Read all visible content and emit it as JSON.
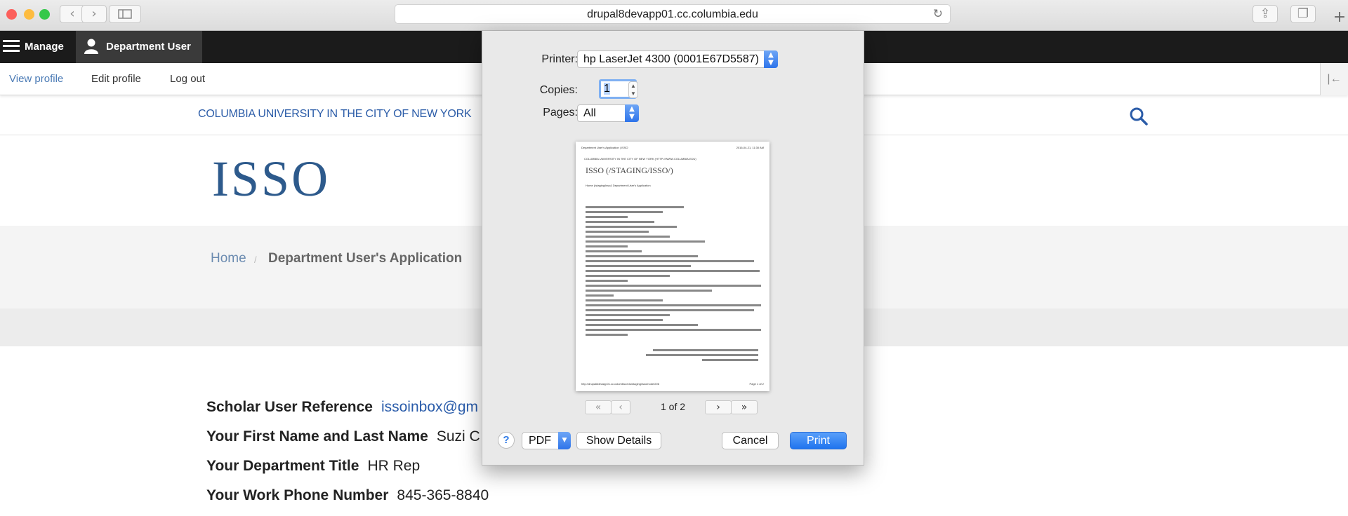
{
  "browser": {
    "url": "drupal8devapp01.cc.columbia.edu",
    "traffic_light_colors": [
      "#fc605c",
      "#fdbc40",
      "#34c84a"
    ],
    "back_icon": "chevron-left-icon",
    "forward_icon": "chevron-right-icon",
    "sidebar_icon": "sidebar-icon",
    "reload_icon": "reload-icon",
    "share_icon": "share-icon",
    "tabs_icon": "tabs-icon",
    "new_tab_icon": "plus-icon"
  },
  "toolbar": {
    "manage_label": "Manage",
    "user_label": "Department User"
  },
  "tray": {
    "view_profile": "View profile",
    "edit_profile": "Edit profile",
    "log_out": "Log out"
  },
  "site": {
    "university": "COLUMBIA UNIVERSITY IN THE CITY OF NEW YORK",
    "logo": "ISSO",
    "breadcrumb_home": "Home",
    "breadcrumb_sep": "/",
    "breadcrumb_current": "Department User's Application",
    "accent_color": "#2b5ca8"
  },
  "fields": [
    {
      "label": "Scholar User Reference",
      "value": "issoinbox@gm"
    },
    {
      "label": "Your First Name and Last Name",
      "value": "Suzi C"
    },
    {
      "label": "Your Department Title",
      "value": "HR Rep"
    },
    {
      "label": "Your Work Phone Number",
      "value": "845-365-8840"
    }
  ],
  "print_dialog": {
    "printer_label": "Printer:",
    "printer_value": "hp LaserJet 4300 (0001E67D5587)",
    "copies_label": "Copies:",
    "copies_value": "1",
    "pages_label": "Pages:",
    "pages_value": "All",
    "preview_header_left": "Department User's Application | ISSO",
    "preview_header_right": "2016-04-21, 11:30 AM",
    "preview_university": "COLUMBIA UNIVERSITY IN THE CITY OF NEW YORK (HTTP://WWW.COLUMBIA.EDU)",
    "preview_title": "ISSO (/STAGING/ISSO/)",
    "preview_breadcrumb": "Home (/staging/isso/)   Department User's Application",
    "preview_footer_left": "http://drupal8devapp01.cc.columbia.edu/staging/isso/node/206",
    "preview_footer_right": "Page 1 of 2",
    "page_counter": "1 of 2",
    "help_label": "?",
    "pdf_label": "PDF",
    "show_details_label": "Show Details",
    "cancel_label": "Cancel",
    "print_label": "Print"
  }
}
